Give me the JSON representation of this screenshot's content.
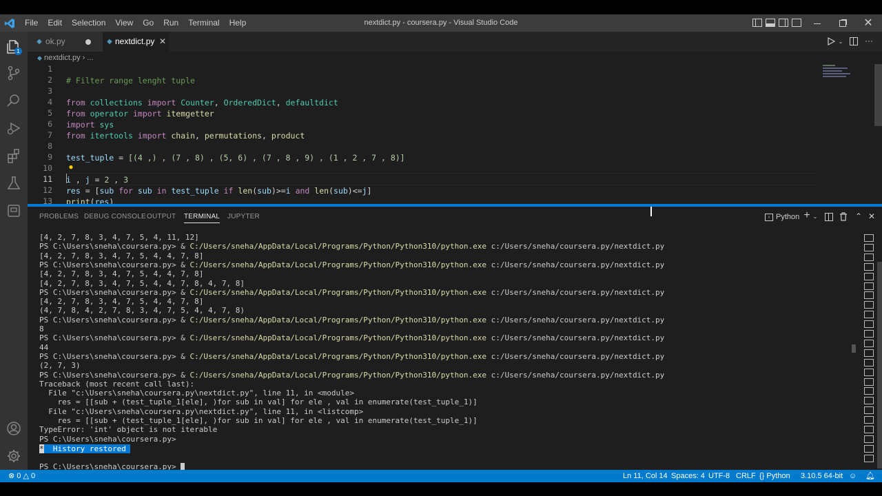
{
  "titlebar": {
    "menu": [
      "File",
      "Edit",
      "Selection",
      "View",
      "Go",
      "Run",
      "Terminal",
      "Help"
    ],
    "title": "nextdict.py - coursera.py - Visual Studio Code"
  },
  "tabs": [
    {
      "label": "ok.py",
      "active": false
    },
    {
      "label": "nextdict.py",
      "active": true
    }
  ],
  "breadcrumb": {
    "file": "nextdict.py",
    "more": "..."
  },
  "editor": {
    "line_numbers": [
      "1",
      "2",
      "3",
      "4",
      "5",
      "6",
      "7",
      "8",
      "9",
      "10",
      "11",
      "12",
      "13"
    ],
    "lines": [
      "",
      "# Filter range lenght tuple",
      "",
      "from collections import Counter, OrderedDict, defaultdict",
      "from operator import itemgetter",
      "import sys",
      "from itertools import chain, permutations, product",
      "",
      "test_tuple = [(4 ,) , (7 , 8) , (5, 6) , (7 , 8 , 9) , (1 , 2 , 7 , 8)]",
      "",
      "i , j = 2 , 3",
      "res = [sub for sub in test_tuple if len(sub)>=i and len(sub)<=j]",
      "print(res)"
    ]
  },
  "panel": {
    "tabs": [
      "PROBLEMS",
      "DEBUG CONSOLE",
      "OUTPUT",
      "TERMINAL",
      "JUPYTER"
    ],
    "active_tab": "TERMINAL",
    "shell_label": "Python",
    "prompt": "PS C:\\Users\\sneha\\coursera.py> ",
    "cmd_amp": "& ",
    "python_path": "C:/Users/sneha/AppData/Local/Programs/Python/Python310/python.exe",
    "script_path": " c:/Users/sneha/coursera.py/nextdict.py",
    "lines": [
      "[4, 2, 7, 8, 3, 4, 7, 5, 4, 11, 12]",
      "CMD",
      "[4, 2, 7, 8, 3, 4, 7, 5, 4, 4, 7, 8]",
      "CMD",
      "[4, 2, 7, 8, 3, 4, 7, 5, 4, 4, 7, 8]",
      "[4, 2, 7, 8, 3, 4, 7, 5, 4, 4, 7, 8, 4, 7, 8]",
      "CMD",
      "[4, 2, 7, 8, 3, 4, 7, 5, 4, 4, 7, 8]",
      "(4, 7, 8, 4, 2, 7, 8, 3, 4, 7, 5, 4, 4, 7, 8)",
      "CMD",
      "8",
      "CMD",
      "44",
      "CMD",
      "(2, 7, 3)",
      "CMD",
      "Traceback (most recent call last):",
      "  File \"c:\\Users\\sneha\\coursera.py\\nextdict.py\", line 11, in <module>",
      "    res = [[sub + (test_tuple_1[ele], )for sub in val] for ele , val in enumerate(test_tuple_1)]",
      "  File \"c:\\Users\\sneha\\coursera.py\\nextdict.py\", line 11, in <listcomp>",
      "    res = [[sub + (test_tuple_1[ele], )for sub in val] for ele , val in enumerate(test_tuple_1)]",
      "TypeError: 'int' object is not iterable",
      "PS C:\\Users\\sneha\\coursera.py>"
    ],
    "history_restored": "  History restored ",
    "history_star": "*",
    "final_prompt": "PS C:\\Users\\sneha\\coursera.py> "
  },
  "statusbar": {
    "errors": "0",
    "warnings": "0",
    "position": "Ln 11, Col 14",
    "spaces": "Spaces: 4",
    "encoding": "UTF-8",
    "eol": "CRLF",
    "language": "Python",
    "interpreter": "3.10.5 64-bit"
  },
  "colors": {
    "accent": "#007acc",
    "panel_border": "#0078d4",
    "python_path": "#dcdcaa"
  }
}
